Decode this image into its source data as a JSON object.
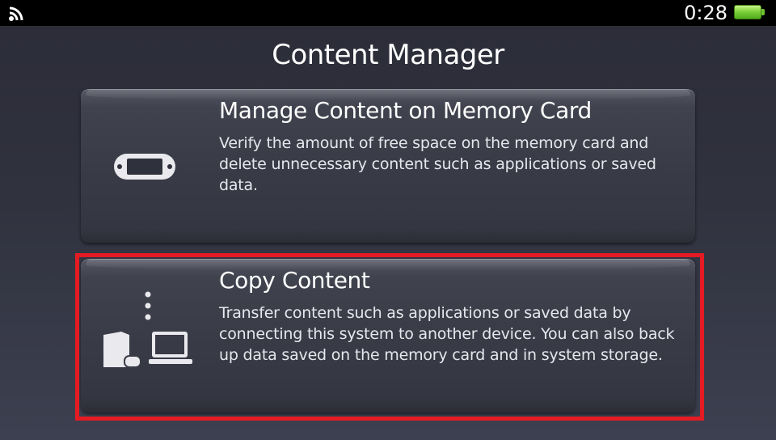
{
  "status_bar": {
    "wifi_icon": "wifi-signal-icon",
    "time": "0:28",
    "battery_icon": "battery-full-icon",
    "battery_color": "#6ec232"
  },
  "title": "Content Manager",
  "options": [
    {
      "heading": "Manage Content on Memory Card",
      "description": "Verify the amount of free space on the memory card and delete unnecessary content such as applications or saved data.",
      "icon": "handheld-console-icon",
      "selected": false
    },
    {
      "heading": "Copy Content",
      "description": "Transfer content such as applications or saved data by connecting this system to another device. You can also back up data saved on the memory card and in system storage.",
      "icon": "console-to-computer-icon",
      "selected": true
    }
  ],
  "colors": {
    "background": "#30323e",
    "status_bar": "#000000",
    "panel": "#393b47",
    "selection_highlight": "#e41b23",
    "text": "#ffffff"
  }
}
